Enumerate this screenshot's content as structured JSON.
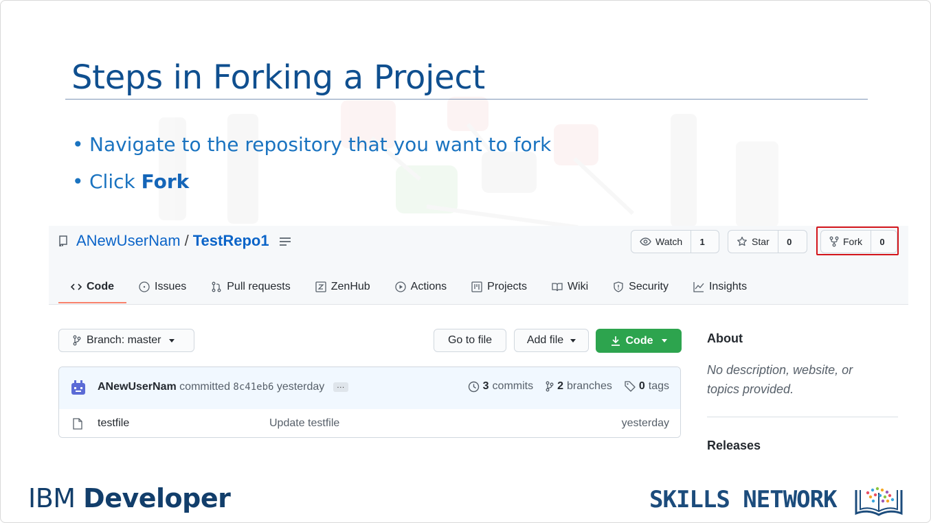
{
  "slide": {
    "title": "Steps in Forking a Project",
    "bullets": [
      {
        "text": "Navigate to the repository that you want to fork",
        "bold": ""
      },
      {
        "text": "Click ",
        "bold": "Fork"
      }
    ],
    "footer_left": {
      "light": "IBM ",
      "bold": "Developer"
    },
    "footer_right": "SKILLS NETWORK"
  },
  "repo": {
    "owner": "ANewUserNam",
    "separator": "/",
    "name": "TestRepo1",
    "watch": {
      "label": "Watch",
      "count": "1"
    },
    "star": {
      "label": "Star",
      "count": "0"
    },
    "fork": {
      "label": "Fork",
      "count": "0"
    },
    "tabs": [
      {
        "label": "Code",
        "icon": "code-icon",
        "active": true
      },
      {
        "label": "Issues",
        "icon": "issue-icon"
      },
      {
        "label": "Pull requests",
        "icon": "pull-request-icon"
      },
      {
        "label": "ZenHub",
        "icon": "zenhub-icon"
      },
      {
        "label": "Actions",
        "icon": "play-icon"
      },
      {
        "label": "Projects",
        "icon": "project-icon"
      },
      {
        "label": "Wiki",
        "icon": "book-icon"
      },
      {
        "label": "Security",
        "icon": "shield-icon"
      },
      {
        "label": "Insights",
        "icon": "graph-icon"
      }
    ],
    "branch_label": "Branch: master",
    "go_to_file": "Go to file",
    "add_file": "Add file",
    "code_button": "Code",
    "commit": {
      "author": "ANewUserNam",
      "action": "committed",
      "sha": "8c41eb6",
      "time": "yesterday",
      "more": "…"
    },
    "stats": {
      "commits_count": "3",
      "commits_label": "commits",
      "branches_count": "2",
      "branches_label": "branches",
      "tags_count": "0",
      "tags_label": "tags"
    },
    "files": [
      {
        "name": "testfile",
        "message": "Update testfile",
        "time": "yesterday"
      }
    ],
    "about": {
      "title": "About",
      "description": "No description, website, or topics provided.",
      "releases": "Releases"
    }
  },
  "colors": {
    "title": "#0f4f8f",
    "bullet": "#1a73c0",
    "link": "#0b64c8",
    "code_button": "#2da44e",
    "highlight": "#d3141a",
    "active_tab_underline": "#f9826c"
  }
}
